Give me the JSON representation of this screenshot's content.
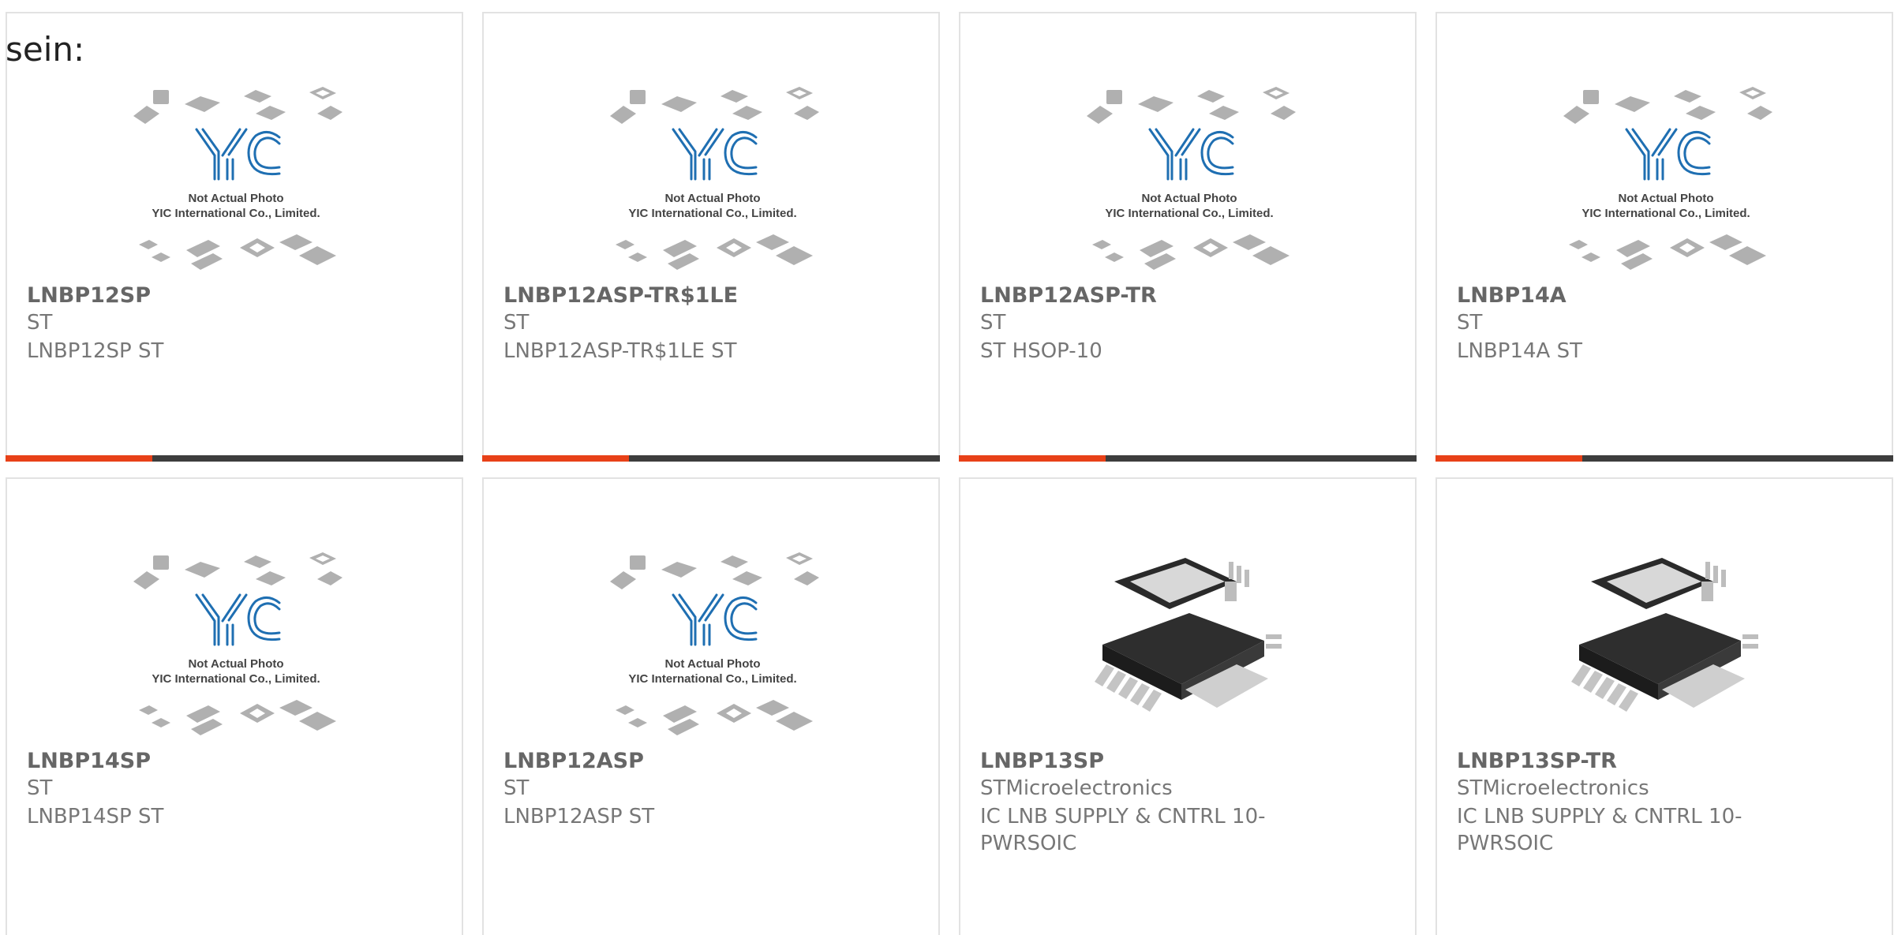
{
  "heading": "sein:",
  "placeholder_caption": {
    "line1": "Not Actual Photo",
    "line2": "YIC International Co., Limited."
  },
  "colors": {
    "accent": "#e84118",
    "bar": "#3d3d3d",
    "logo_blue": "#1f6fb2"
  },
  "products": [
    {
      "part": "LNBP12SP",
      "maker": "ST",
      "desc": "LNBP12SP ST",
      "image": "placeholder",
      "accent_progress": 0.32
    },
    {
      "part": "LNBP12ASP-TR$1LE",
      "maker": "ST",
      "desc": "LNBP12ASP-TR$1LE ST",
      "image": "placeholder",
      "accent_progress": 0.32
    },
    {
      "part": "LNBP12ASP-TR",
      "maker": "ST",
      "desc": "ST HSOP-10",
      "image": "placeholder",
      "accent_progress": 0.32
    },
    {
      "part": "LNBP14A",
      "maker": "ST",
      "desc": "LNBP14A ST",
      "image": "placeholder",
      "accent_progress": 0.32
    },
    {
      "part": "LNBP14SP",
      "maker": "ST",
      "desc": "LNBP14SP ST",
      "image": "placeholder"
    },
    {
      "part": "LNBP12ASP",
      "maker": "ST",
      "desc": "LNBP12ASP ST",
      "image": "placeholder"
    },
    {
      "part": "LNBP13SP",
      "maker": "STMicroelectronics",
      "desc": "IC LNB SUPPLY & CNTRL 10-PWRSOIC",
      "image": "chip-photo"
    },
    {
      "part": "LNBP13SP-TR",
      "maker": "STMicroelectronics",
      "desc": "IC LNB SUPPLY & CNTRL 10-PWRSOIC",
      "image": "chip-photo"
    }
  ]
}
